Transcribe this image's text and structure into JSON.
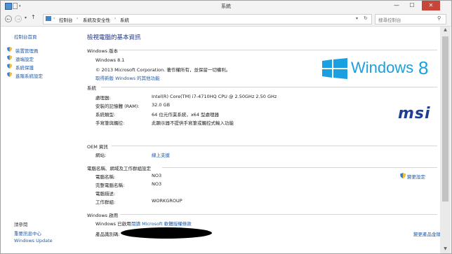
{
  "window": {
    "title": "系統",
    "minimize": "—",
    "maximize": "☐",
    "close": "✕"
  },
  "address": {
    "crumbs": [
      "控制台",
      "系統及安全性",
      "系統"
    ],
    "separator": "›",
    "search_placeholder": "搜尋控制台"
  },
  "sidebar": {
    "home": "控制台首頁",
    "items": [
      {
        "label": "裝置管理員"
      },
      {
        "label": "遠端設定"
      },
      {
        "label": "系統保護"
      },
      {
        "label": "進階系統設定"
      }
    ],
    "see_also": "請參閱",
    "bottom_links": [
      "重要訊息中心",
      "Windows Update"
    ]
  },
  "main": {
    "heading": "檢視電腦的基本資訊",
    "edition": {
      "title": "Windows 版本",
      "name": "Windows 8.1",
      "copyright": "© 2013 Microsoft Corporation. 著作權所有，並保留一切權利。",
      "more_link": "取得新版 Windows 的其他功能"
    },
    "logo": {
      "text": "Windows",
      "number": "8"
    },
    "brand_logo": "msi",
    "system": {
      "title": "系統",
      "rows": [
        {
          "label": "處理器:",
          "value": "Intel(R) Core(TM) i7-4710HQ CPU @ 2.50GHz   2.50 GHz"
        },
        {
          "label": "安裝的記憶體 (RAM):",
          "value": "32.0 GB"
        },
        {
          "label": "系統類型:",
          "value": "64 位元作業系統，x64 型處理器"
        },
        {
          "label": "手寫筆與觸控:",
          "value": "此顯示器不提供手寫筆或觸控式輸入功能"
        }
      ]
    },
    "oem": {
      "title": "OEM 資訊",
      "label": "網站:",
      "link": "線上支援"
    },
    "computer": {
      "title": "電腦名稱、網域及工作群組設定",
      "change_link": "變更設定",
      "rows": [
        {
          "label": "電腦名稱:",
          "value": "NO3"
        },
        {
          "label": "完整電腦名稱:",
          "value": "NO3"
        },
        {
          "label": "電腦描述:",
          "value": ""
        },
        {
          "label": "工作群組:",
          "value": "WORKGROUP"
        }
      ]
    },
    "activation": {
      "title": "Windows 啟用",
      "status": "Windows 已啟用",
      "license_link": "閱讀 Microsoft 軟體授權條款",
      "product_id_label": "產品識別碼:",
      "change_key_link": "變更產品金鑰"
    }
  },
  "colors": {
    "windows_blue": "#1aa0e0",
    "msi_blue": "#1d3f93",
    "link": "#1f5aa8",
    "heading": "#1e3287"
  }
}
